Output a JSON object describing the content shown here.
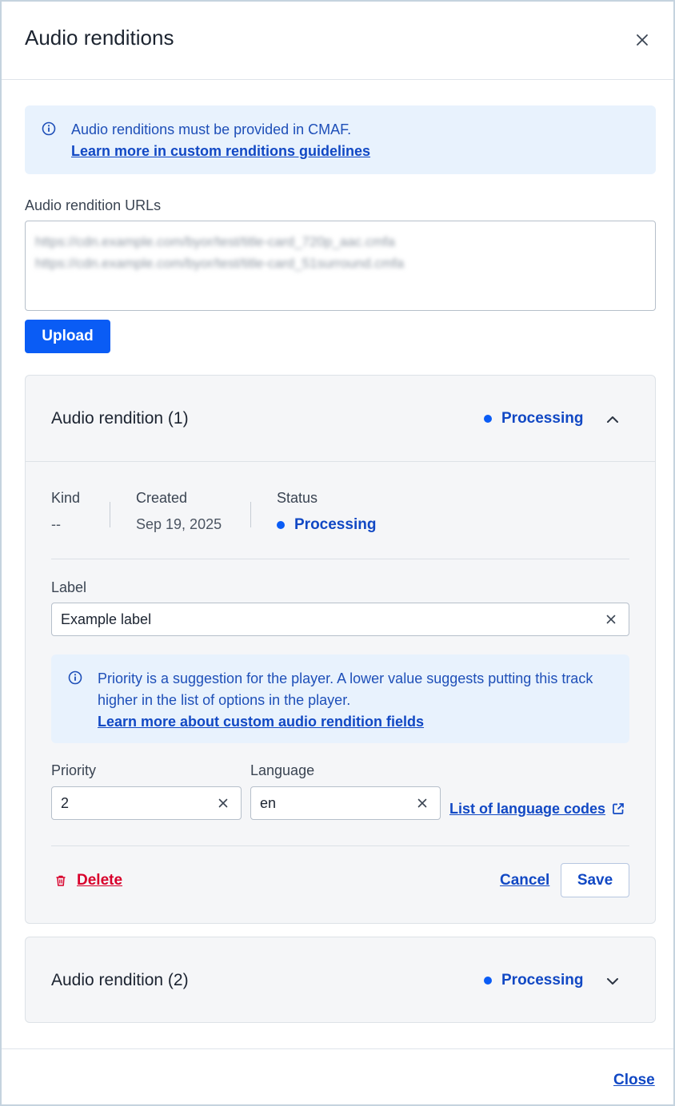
{
  "dialog": {
    "title": "Audio renditions",
    "close_icon": "close-icon"
  },
  "info_banner": {
    "text": "Audio renditions must be provided in CMAF.",
    "link": "Learn more in custom renditions guidelines"
  },
  "urls_field": {
    "label": "Audio rendition URLs",
    "lines": [
      "https://cdn.example.com/byor/test/title-card_720p_aac.cmfa",
      "https://cdn.example.com/byor/test/title-card_51surround.cmfa"
    ]
  },
  "upload_button": "Upload",
  "renditions": [
    {
      "title": "Audio rendition (1)",
      "status": "Processing",
      "expanded": true,
      "meta": {
        "kind_label": "Kind",
        "kind_value": "--",
        "created_label": "Created",
        "created_value": "Sep 19, 2025",
        "status_label": "Status",
        "status_value": "Processing"
      },
      "label_field": {
        "label": "Label",
        "value": "Example label"
      },
      "priority_banner": {
        "text": "Priority is a suggestion for the player. A lower value suggests putting this track higher in the list of options in the player.",
        "link": "Learn more about custom audio rendition fields"
      },
      "priority_field": {
        "label": "Priority",
        "value": "2"
      },
      "language_field": {
        "label": "Language",
        "value": "en"
      },
      "language_codes_link": "List of language codes",
      "delete_label": "Delete",
      "cancel_label": "Cancel",
      "save_label": "Save"
    },
    {
      "title": "Audio rendition (2)",
      "status": "Processing",
      "expanded": false
    }
  ],
  "footer": {
    "close_label": "Close"
  },
  "colors": {
    "accent": "#0a5cf5",
    "link": "#1148c4",
    "danger": "#d8002b",
    "banner_bg": "#e8f2fd"
  }
}
